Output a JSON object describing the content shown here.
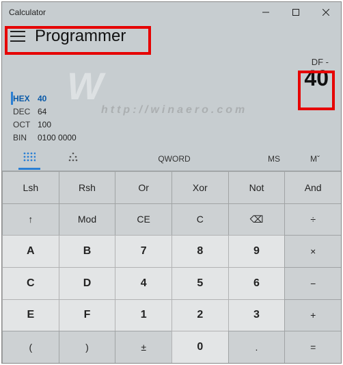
{
  "window": {
    "title": "Calculator"
  },
  "header": {
    "mode": "Programmer"
  },
  "display": {
    "expression": "DF -",
    "result": "40"
  },
  "bases": {
    "hex": {
      "label": "HEX",
      "value": "40"
    },
    "dec": {
      "label": "DEC",
      "value": "64"
    },
    "oct": {
      "label": "OCT",
      "value": "100"
    },
    "bin": {
      "label": "BIN",
      "value": "0100 0000"
    }
  },
  "toolbar": {
    "word": "QWORD",
    "ms": "MS",
    "mr": "Mˇ"
  },
  "keys": {
    "lsh": "Lsh",
    "rsh": "Rsh",
    "or": "Or",
    "xor": "Xor",
    "not": "Not",
    "and": "And",
    "up": "↑",
    "mod": "Mod",
    "ce": "CE",
    "c": "C",
    "bksp": "⌫",
    "div": "÷",
    "a": "A",
    "b": "B",
    "k7": "7",
    "k8": "8",
    "k9": "9",
    "mul": "×",
    "cc": "C",
    "d": "D",
    "k4": "4",
    "k5": "5",
    "k6": "6",
    "sub": "−",
    "e": "E",
    "f": "F",
    "k1": "1",
    "k2": "2",
    "k3": "3",
    "add": "+",
    "lpar": "(",
    "rpar": ")",
    "plusminus": "±",
    "k0": "0",
    "dot": ".",
    "eq": "="
  }
}
